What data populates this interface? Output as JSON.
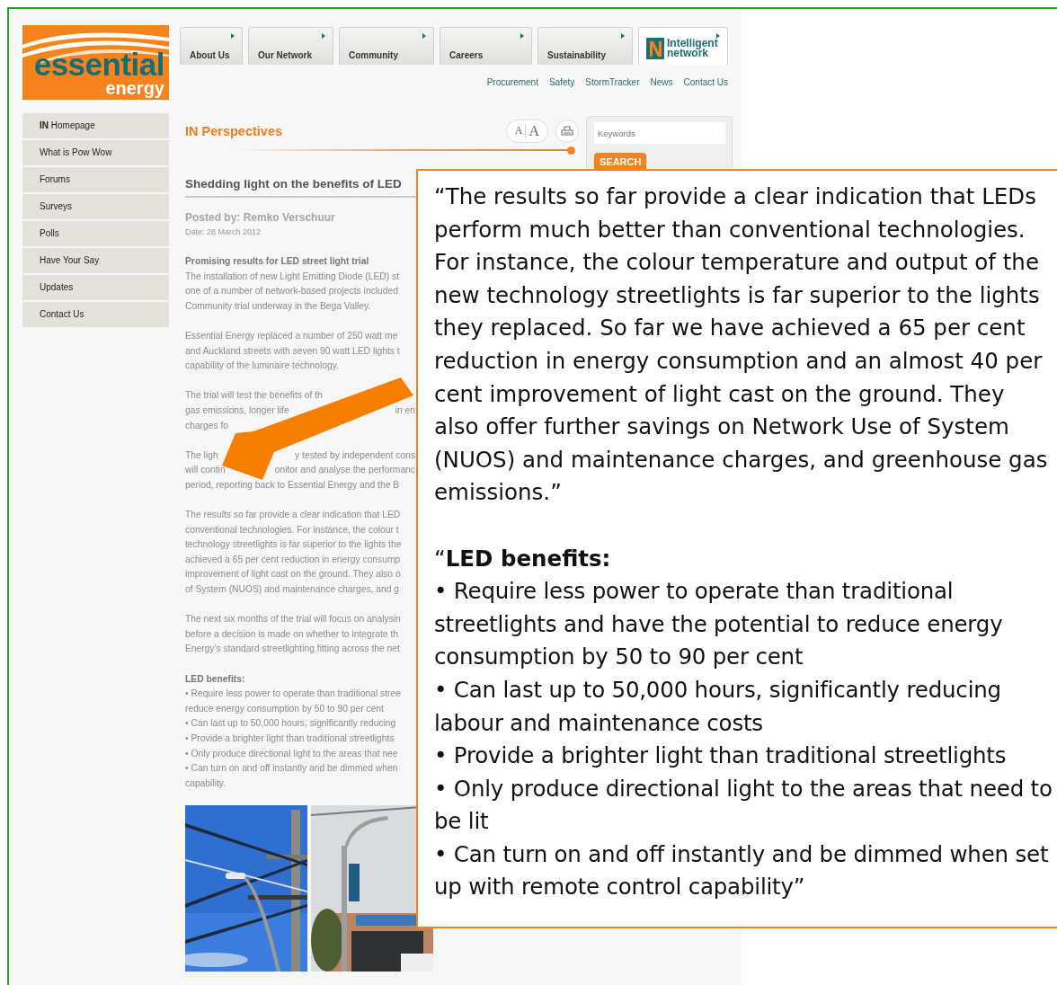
{
  "logo": {
    "line_1": "essential",
    "line_2": "energy"
  },
  "tabs": [
    {
      "kind": "text",
      "label": "About Us",
      "selected": false
    },
    {
      "kind": "text",
      "label": "Our Network",
      "selected": false
    },
    {
      "kind": "text",
      "label": "Community",
      "selected": false
    },
    {
      "kind": "text",
      "label": "Careers",
      "selected": false
    },
    {
      "kind": "text",
      "label": "Sustainability",
      "selected": false
    },
    {
      "kind": "logo",
      "label_1": "Intelligent",
      "label_2": "network",
      "selected": true
    }
  ],
  "top_links": [
    "Procurement",
    "Safety",
    "StormTracker",
    "News",
    "Contact Us"
  ],
  "sidebar": {
    "items": [
      "**IN** Homepage",
      "What is Pow Wow",
      "Forums",
      "Surveys",
      "Polls",
      "Have Your Say",
      "Updates",
      "Contact Us"
    ]
  },
  "section_title": "IN Perspectives",
  "text_size_buttons": [
    "A",
    "A"
  ],
  "search": {
    "placeholder": "Keywords",
    "button": "SEARCH"
  },
  "article": {
    "title": "Shedding light on the benefits of LED",
    "posted_by": "Posted by: Remko Verschuur",
    "date": "Date: 28 March 2012",
    "paragraphs": [
      {
        "heading": "Promising results for LED street light trial",
        "lines": [
          "The installation of new Light Emitting Diode (LED) st",
          "one of a number of network-based projects included",
          "Community trial underway in the Bega Valley."
        ]
      },
      {
        "lines": [
          "Essential Energy replaced a number of 250 watt me",
          "and Auckland streets with seven 90 watt LED lights t",
          "capability of the luminaire technology."
        ]
      },
      {
        "lines": [
          "The trial will test the benefits of th",
          {
            "text": "gas emissions, longer life",
            "tail": "in en"
          },
          "charges fo"
        ]
      },
      {
        "lines": [
          {
            "text": "The ligh",
            "tail": "y tested by independent cons"
          },
          {
            "text": "will contin",
            "tail": "onitor and analyse the performanc"
          },
          "period, reporting back to Essential Energy and the B"
        ]
      },
      {
        "lines": [
          "The results so far provide a clear indication that LED",
          "conventional technologies. For instance, the colour t",
          "technology streetlights is far superior to the lights the",
          "achieved a 65 per cent reduction in energy consump",
          "improvement of light cast on the ground. They also o",
          "of System (NUOS) and maintenance charges, and g"
        ]
      },
      {
        "lines": [
          "The next six months of the trial will focus on analysin",
          "before a decision is made on whether to integrate th",
          "Energy's standard streetlighting fitting across the net"
        ]
      },
      {
        "heading": "LED benefits:",
        "lines": [
          "• Require less power to operate than traditional stree",
          "reduce energy consumption by 50 to 90 per cent",
          "• Can last up to 50,000 hours, significantly reducing",
          "• Provide a brighter light than traditional streetlights",
          "• Only produce directional light to the areas that nee",
          "• Can turn on and off instantly and be dimmed when",
          "capability."
        ]
      }
    ]
  },
  "callout": {
    "quote": "“The results so far provide a clear indication that LEDs perform much better than conventional technologies. For instance, the colour temperature and output of the new technology streetlights is far superior to the lights they replaced. So far we have achieved a 65 per cent reduction in energy consumption and an almost 40 per cent improvement of light cast on the ground. They also offer further savings on Network Use of System (NUOS) and maintenance charges, and greenhouse gas emissions.”",
    "benefits_heading": "“**LED benefits:**",
    "benefits": [
      "• Require less power to operate than traditional streetlights and have the potential to reduce energy consumption by 50 to 90 per cent",
      "• Can last up to 50,000 hours, significantly reducing labour and maintenance costs",
      "• Provide a brighter light than traditional streetlights",
      "• Only produce directional light to the areas that need to be lit",
      "• Can turn on and off instantly and be dimmed when set up with remote control capability”"
    ]
  }
}
